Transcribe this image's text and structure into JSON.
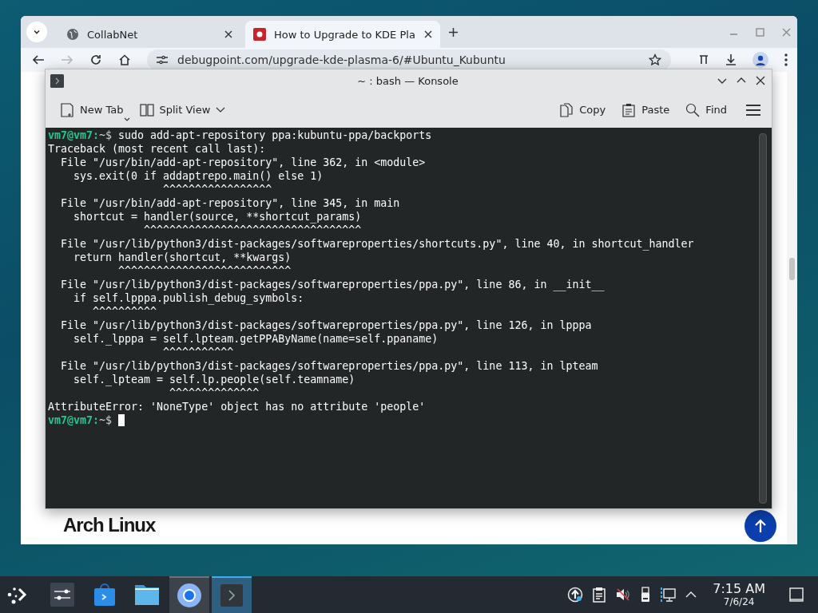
{
  "browser": {
    "tabs": [
      {
        "title": "CollabNet",
        "selected": false
      },
      {
        "title": "How to Upgrade to KDE Pla",
        "selected": true
      }
    ],
    "forward_disabled": true,
    "url": "debugpoint.com/upgrade-kde-plasma-6/#Ubuntu_Kubuntu",
    "page": {
      "heading": "Arch Linux"
    }
  },
  "konsole": {
    "title": "~ : bash — Konsole",
    "toolbar_left": [
      {
        "label": "New Tab"
      },
      {
        "label": "Split View"
      }
    ],
    "toolbar_right": [
      {
        "label": "Copy"
      },
      {
        "label": "Paste"
      },
      {
        "label": "Find"
      }
    ],
    "lines": [
      {
        "kind": "prompt",
        "user_host": "vm7@vm7:",
        "cwd": "~$",
        "command": "sudo add-apt-repository ppa:kubuntu-ppa/backports",
        "cursor": false
      },
      {
        "kind": "output",
        "text": "Traceback (most recent call last):"
      },
      {
        "kind": "output",
        "text": "  File \"/usr/bin/add-apt-repository\", line 362, in <module>"
      },
      {
        "kind": "output",
        "text": "    sys.exit(0 if addaptrepo.main() else 1)"
      },
      {
        "kind": "output",
        "text": "                  ^^^^^^^^^^^^^^^^^"
      },
      {
        "kind": "output",
        "text": "  File \"/usr/bin/add-apt-repository\", line 345, in main"
      },
      {
        "kind": "output",
        "text": "    shortcut = handler(source, **shortcut_params)"
      },
      {
        "kind": "output",
        "text": "               ^^^^^^^^^^^^^^^^^^^^^^^^^^^^^^^^^^"
      },
      {
        "kind": "output",
        "text": "  File \"/usr/lib/python3/dist-packages/softwareproperties/shortcuts.py\", line 40, in shortcut_handler"
      },
      {
        "kind": "output",
        "text": "    return handler(shortcut, **kwargs)"
      },
      {
        "kind": "output",
        "text": "           ^^^^^^^^^^^^^^^^^^^^^^^^^^^"
      },
      {
        "kind": "output",
        "text": "  File \"/usr/lib/python3/dist-packages/softwareproperties/ppa.py\", line 86, in __init__"
      },
      {
        "kind": "output",
        "text": "    if self.lpppa.publish_debug_symbols:"
      },
      {
        "kind": "output",
        "text": "       ^^^^^^^^^^"
      },
      {
        "kind": "output",
        "text": "  File \"/usr/lib/python3/dist-packages/softwareproperties/ppa.py\", line 126, in lpppa"
      },
      {
        "kind": "output",
        "text": "    self._lpppa = self.lpteam.getPPAByName(name=self.ppaname)"
      },
      {
        "kind": "output",
        "text": "                  ^^^^^^^^^^^"
      },
      {
        "kind": "output",
        "text": "  File \"/usr/lib/python3/dist-packages/softwareproperties/ppa.py\", line 113, in lpteam"
      },
      {
        "kind": "output",
        "text": "    self._lpteam = self.lp.people(self.teamname)"
      },
      {
        "kind": "output",
        "text": "                   ^^^^^^^^^^^^^^"
      },
      {
        "kind": "output",
        "text": "AttributeError: 'NoneType' object has no attribute 'people'"
      },
      {
        "kind": "prompt",
        "user_host": "vm7@vm7:",
        "cwd": "~$",
        "cursor": true
      }
    ]
  },
  "taskbar": {
    "apps": [
      {
        "running": false,
        "selected": false
      },
      {
        "running": false,
        "selected": false
      },
      {
        "running": false,
        "selected": false
      },
      {
        "running": true,
        "selected": false
      },
      {
        "running": true,
        "selected": true
      }
    ],
    "clock": {
      "time": "7:15 AM",
      "date": "7/6/24"
    }
  }
}
